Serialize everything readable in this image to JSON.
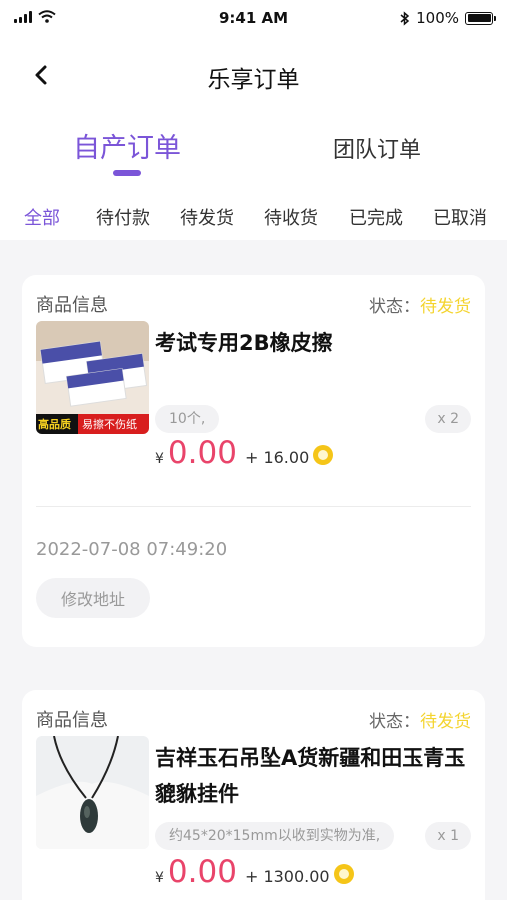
{
  "status_bar": {
    "time": "9:41 AM",
    "battery": "100%"
  },
  "nav": {
    "title": "乐享订单"
  },
  "tabs": [
    {
      "label": "自产订单"
    },
    {
      "label": "团队订单"
    }
  ],
  "filters": [
    {
      "label": "全部"
    },
    {
      "label": "待付款"
    },
    {
      "label": "待发货"
    },
    {
      "label": "待收货"
    },
    {
      "label": "已完成"
    },
    {
      "label": "已取消"
    }
  ],
  "orders": [
    {
      "info_label": "商品信息",
      "status_prefix": "状态：",
      "status": "待发货",
      "title": "考试专用2B橡皮擦",
      "spec": "10个,",
      "qty": "x 2",
      "currency": "¥",
      "price": "0.00",
      "points": "+ 16.00",
      "thumb_tag_left": "高品质",
      "thumb_tag_right": "易擦不伤纸",
      "time": "2022-07-08 07:49:20",
      "action": "修改地址"
    },
    {
      "info_label": "商品信息",
      "status_prefix": "状态：",
      "status": "待发货",
      "title": "吉祥玉石吊坠A货新疆和田玉青玉貔貅挂件",
      "spec": "约45*20*15mm以收到实物为准,",
      "qty": "x 1",
      "currency": "¥",
      "price": "0.00",
      "points": "+ 1300.00"
    }
  ],
  "colors": {
    "accent": "#7b55d8",
    "price": "#e9446a",
    "status": "#f4d42f"
  }
}
